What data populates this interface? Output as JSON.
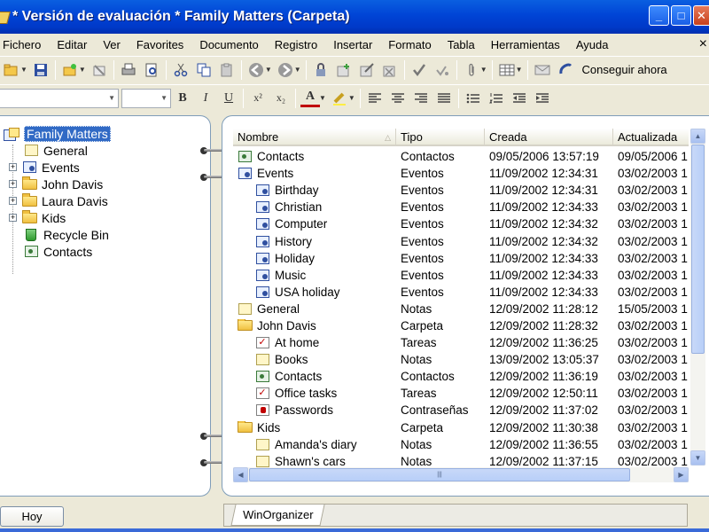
{
  "window": {
    "title": "* Versión de evaluación * Family Matters (Carpeta)",
    "minimize_glyph": "_",
    "maximize_glyph": "□",
    "close_glyph": "✕"
  },
  "menu": [
    "Fichero",
    "Editar",
    "Ver",
    "Favorites",
    "Documento",
    "Registro",
    "Insertar",
    "Formato",
    "Tabla",
    "Herramientas",
    "Ayuda"
  ],
  "menu_close_glyph": "×",
  "toolbar": {
    "get_now_label": "Conseguir ahora",
    "format_buttons": [
      "B",
      "I",
      "U",
      "x²",
      "x₂",
      "A"
    ]
  },
  "tree": {
    "root": "Family Matters",
    "items": [
      {
        "label": "General",
        "icon": "note-icon",
        "expandable": false
      },
      {
        "label": "Events",
        "icon": "event-folder-icon",
        "expandable": true
      },
      {
        "label": "John Davis",
        "icon": "folder-icon",
        "expandable": true
      },
      {
        "label": "Laura Davis",
        "icon": "folder-icon",
        "expandable": true
      },
      {
        "label": "Kids",
        "icon": "folder-icon",
        "expandable": true
      },
      {
        "label": "Recycle Bin",
        "icon": "recycle-bin-icon",
        "expandable": false
      },
      {
        "label": "Contacts",
        "icon": "contacts-icon",
        "expandable": false
      }
    ]
  },
  "list": {
    "columns": [
      "Nombre",
      "Tipo",
      "Creada",
      "Actualizada"
    ],
    "sort_glyph": "△",
    "rows": [
      {
        "name": "Contacts",
        "type": "Contactos",
        "created": "09/05/2006 13:57:19",
        "updated": "09/05/2006 1",
        "icon": "contact",
        "indent": 0
      },
      {
        "name": "Events",
        "type": "Eventos",
        "created": "11/09/2002 12:34:31",
        "updated": "03/02/2003 1",
        "icon": "event",
        "indent": 0
      },
      {
        "name": "Birthday",
        "type": "Eventos",
        "created": "11/09/2002 12:34:31",
        "updated": "03/02/2003 1",
        "icon": "event",
        "indent": 1
      },
      {
        "name": "Christian",
        "type": "Eventos",
        "created": "11/09/2002 12:34:33",
        "updated": "03/02/2003 1",
        "icon": "event",
        "indent": 1
      },
      {
        "name": "Computer",
        "type": "Eventos",
        "created": "11/09/2002 12:34:32",
        "updated": "03/02/2003 1",
        "icon": "event",
        "indent": 1
      },
      {
        "name": "History",
        "type": "Eventos",
        "created": "11/09/2002 12:34:32",
        "updated": "03/02/2003 1",
        "icon": "event",
        "indent": 1
      },
      {
        "name": "Holiday",
        "type": "Eventos",
        "created": "11/09/2002 12:34:33",
        "updated": "03/02/2003 1",
        "icon": "event",
        "indent": 1
      },
      {
        "name": "Music",
        "type": "Eventos",
        "created": "11/09/2002 12:34:33",
        "updated": "03/02/2003 1",
        "icon": "event",
        "indent": 1
      },
      {
        "name": "USA holiday",
        "type": "Eventos",
        "created": "11/09/2002 12:34:33",
        "updated": "03/02/2003 1",
        "icon": "event",
        "indent": 1
      },
      {
        "name": "General",
        "type": "Notas",
        "created": "12/09/2002 11:28:12",
        "updated": "15/05/2003 1",
        "icon": "note",
        "indent": 0
      },
      {
        "name": "John Davis",
        "type": "Carpeta",
        "created": "12/09/2002 11:28:32",
        "updated": "03/02/2003 1",
        "icon": "folder",
        "indent": 0
      },
      {
        "name": "At home",
        "type": "Tareas",
        "created": "12/09/2002 11:36:25",
        "updated": "03/02/2003 1",
        "icon": "task",
        "indent": 1
      },
      {
        "name": "Books",
        "type": "Notas",
        "created": "13/09/2002 13:05:37",
        "updated": "03/02/2003 1",
        "icon": "note",
        "indent": 1
      },
      {
        "name": "Contacts",
        "type": "Contactos",
        "created": "12/09/2002 11:36:19",
        "updated": "03/02/2003 1",
        "icon": "contact",
        "indent": 1
      },
      {
        "name": "Office tasks",
        "type": "Tareas",
        "created": "12/09/2002 12:50:11",
        "updated": "03/02/2003 1",
        "icon": "task",
        "indent": 1
      },
      {
        "name": "Passwords",
        "type": "Contraseñas",
        "created": "12/09/2002 11:37:02",
        "updated": "03/02/2003 1",
        "icon": "pwd",
        "indent": 1
      },
      {
        "name": "Kids",
        "type": "Carpeta",
        "created": "12/09/2002 11:30:38",
        "updated": "03/02/2003 1",
        "icon": "folder",
        "indent": 0
      },
      {
        "name": "Amanda's diary",
        "type": "Notas",
        "created": "12/09/2002 11:36:55",
        "updated": "03/02/2003 1",
        "icon": "note",
        "indent": 1
      },
      {
        "name": "Shawn's cars",
        "type": "Notas",
        "created": "12/09/2002 11:37:15",
        "updated": "03/02/2003 1",
        "icon": "note",
        "indent": 1
      }
    ]
  },
  "scroll": {
    "up_glyph": "▲",
    "down_glyph": "▼",
    "left_glyph": "◀",
    "right_glyph": "▶",
    "thumb_grip": "|||"
  },
  "bottom": {
    "today_button": "Hoy",
    "tab_label": "WinOrganizer"
  },
  "colors": {
    "titlebar": "#0044d6",
    "selection": "#316ac5",
    "face": "#ece9d8"
  }
}
